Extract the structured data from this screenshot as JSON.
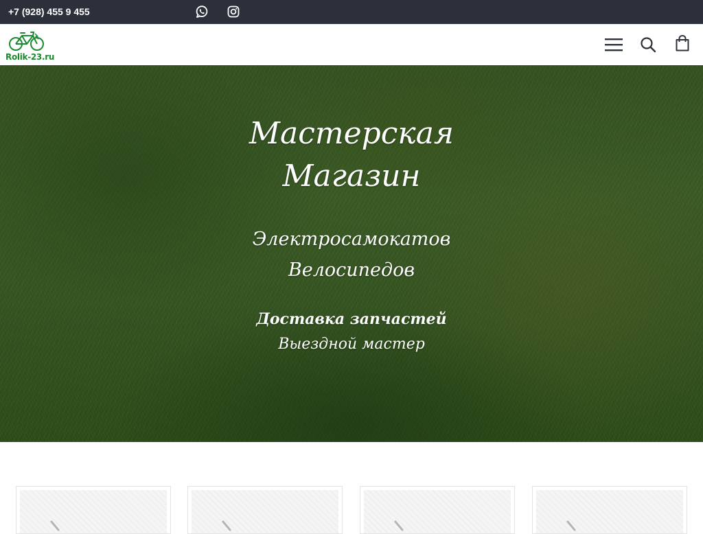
{
  "topbar": {
    "phone": "+7 (928) 455 9 455",
    "icons": [
      "whatsapp-icon",
      "instagram-icon"
    ],
    "bg_color": "#2b303a"
  },
  "header": {
    "logo_text": "Rolik-23.ru",
    "logo_color": "#1a8a2e",
    "icons": [
      "menu-icon",
      "search-icon",
      "shopping-bag-icon"
    ]
  },
  "hero": {
    "title_line1": "Мастерская",
    "title_line2": "Магазин",
    "subtitle_line1": "Электросамокатов",
    "subtitle_line2": "Велосипедов",
    "service_line1": "Доставка запчастей",
    "service_line2": "Выездной мастер"
  },
  "cards": {
    "count": 4
  }
}
